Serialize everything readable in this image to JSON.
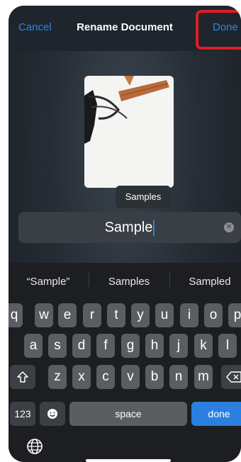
{
  "nav": {
    "cancel_label": "Cancel",
    "title": "Rename Document",
    "done_label": "Done"
  },
  "tooltip": {
    "text": "Samples"
  },
  "name_field": {
    "value": "Sample"
  },
  "suggestions": [
    "“Sample”",
    "Samples",
    "Sampled"
  ],
  "keyboard": {
    "row1": [
      "q",
      "w",
      "e",
      "r",
      "t",
      "y",
      "u",
      "i",
      "o",
      "p"
    ],
    "row2": [
      "a",
      "s",
      "d",
      "f",
      "g",
      "h",
      "j",
      "k",
      "l"
    ],
    "row3": [
      "z",
      "x",
      "c",
      "v",
      "b",
      "n",
      "m"
    ],
    "numbers_label": "123",
    "space_label": "space",
    "done_label": "done"
  },
  "icons": {
    "shift": "shift-icon",
    "delete": "delete-icon",
    "emoji": "emoji-icon",
    "globe": "globe-icon",
    "clear": "clear-text-icon"
  },
  "colors": {
    "accent": "#2b86e6",
    "highlight": "#e11b24"
  }
}
